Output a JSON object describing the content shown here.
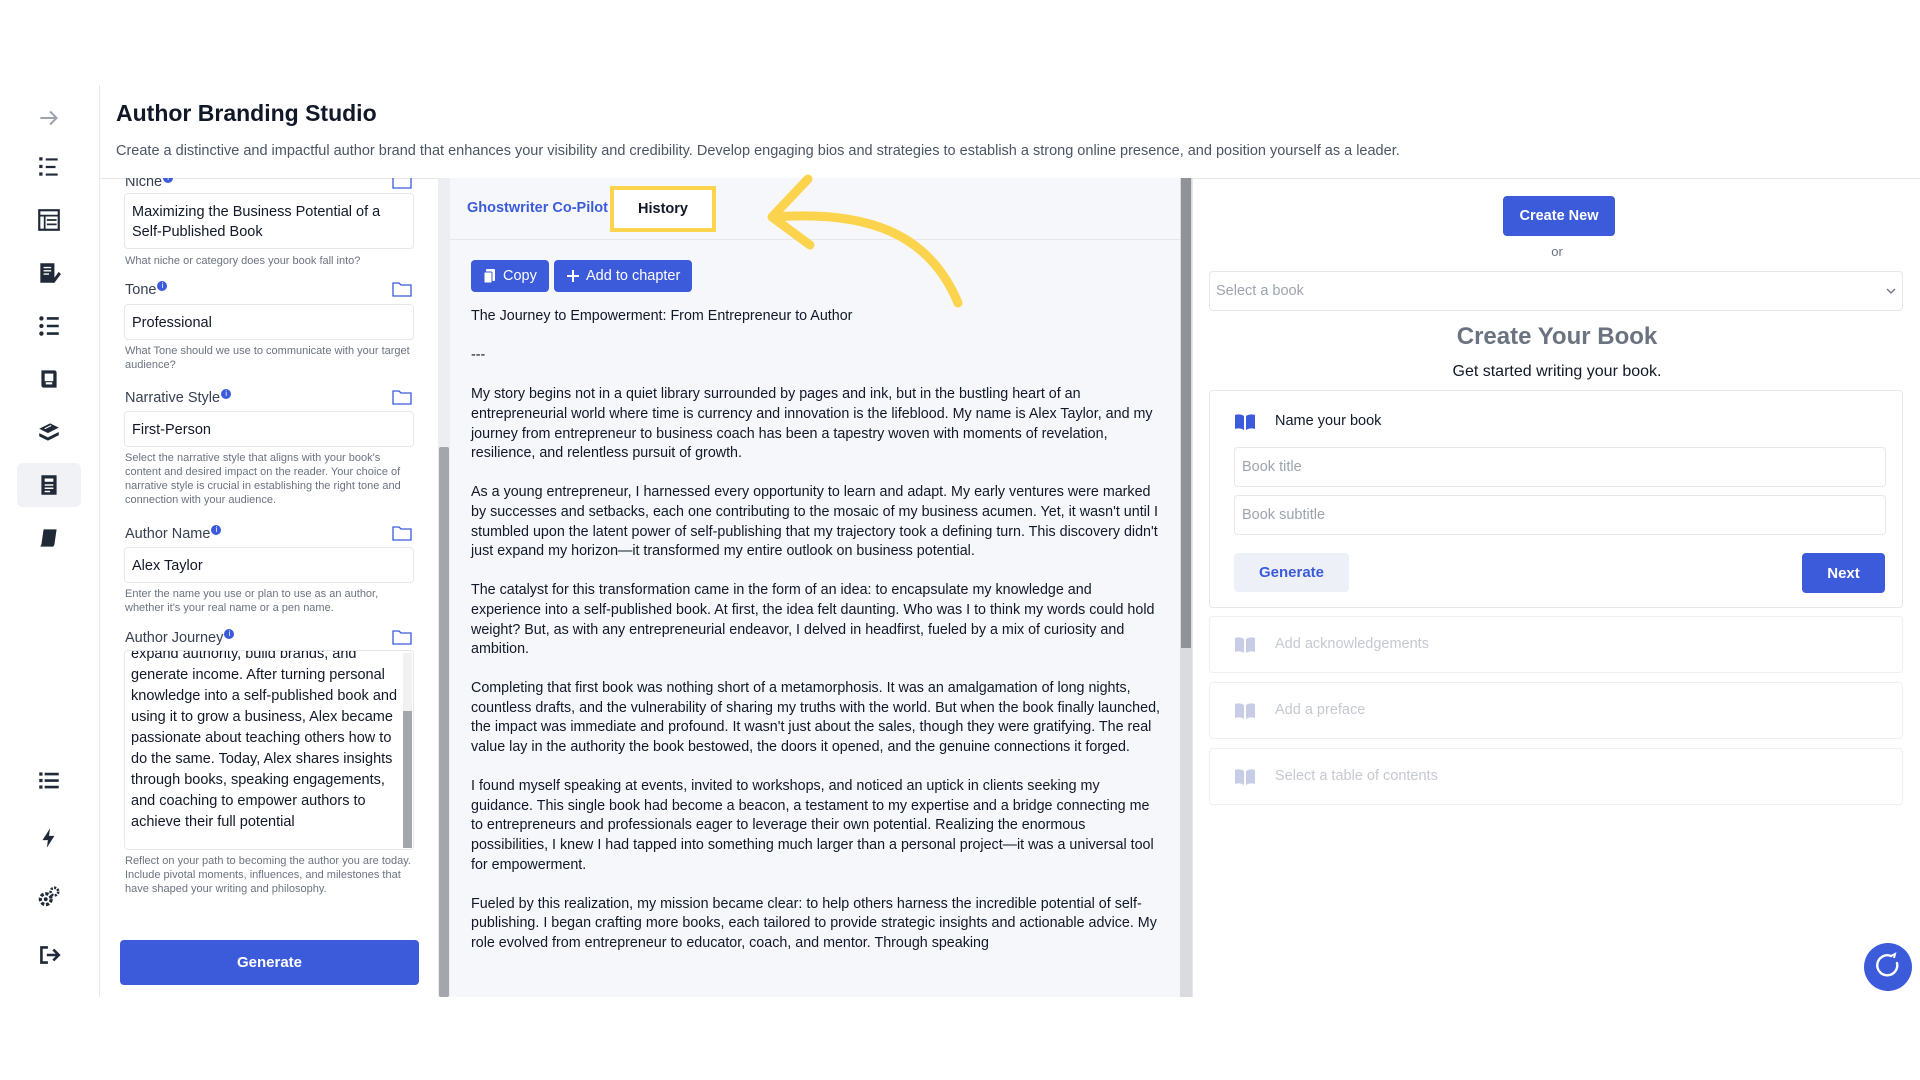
{
  "header": {
    "title": "Author Branding Studio",
    "description": "Create a distinctive and impactful author brand that enhances your visibility and credibility. Develop engaging bios and strategies to establish a strong online presence, and position yourself as a leader."
  },
  "sidebar": {
    "top_icons": [
      "arrow-right-icon",
      "numbered-list-icon",
      "table-layout-icon",
      "notebook-edit-icon",
      "checklist-icon",
      "book-reader-icon",
      "books-stack-icon",
      "author-branding-icon",
      "closed-book-icon"
    ],
    "bottom_icons": [
      "list-icon",
      "lightning-icon",
      "settings-gears-icon",
      "logout-icon"
    ]
  },
  "form": {
    "niche": {
      "label": "Niche",
      "value": "Maximizing the Business Potential of a Self-Published Book",
      "help": "What niche or category does your book fall into?"
    },
    "tone": {
      "label": "Tone",
      "value": "Professional",
      "help": "What Tone should we use to communicate with your target audience?"
    },
    "narrative_style": {
      "label": "Narrative Style",
      "value": "First-Person",
      "help": "Select the narrative style that aligns with your book's content and desired impact on the reader. Your choice of narrative style is crucial in establishing the right tone and connection with your audience."
    },
    "author_name": {
      "label": "Author Name",
      "value": "Alex Taylor",
      "help": "Enter the name you use or plan to use as an author, whether it's your real name or a pen name."
    },
    "author_journey": {
      "label": "Author Journey",
      "value": "expand authority, build brands, and generate income. After turning personal knowledge into a self-published book and using it to grow a business, Alex became passionate about teaching others how to do the same. Today, Alex shares insights through books, speaking engagements, and coaching to empower authors to achieve their full potential",
      "help": "Reflect on your path to becoming the author you are today. Include pivotal moments, influences, and milestones that have shaped your writing and philosophy."
    },
    "generate_label": "Generate"
  },
  "middle": {
    "tabs": [
      "Ghostwriter Co-Pilot",
      "History"
    ],
    "copy_label": "Copy",
    "add_chapter_label": "Add to chapter",
    "story": [
      "The Journey to Empowerment: From Entrepreneur to Author",
      "---",
      "My story begins not in a quiet library surrounded by pages and ink, but in the bustling heart of an entrepreneurial world where time is currency and innovation is the lifeblood. My name is Alex Taylor, and my journey from entrepreneur to business coach has been a tapestry woven with moments of revelation, resilience, and relentless pursuit of growth.",
      "As a young entrepreneur, I harnessed every opportunity to learn and adapt. My early ventures were marked by successes and setbacks, each one contributing to the mosaic of my business acumen. Yet, it wasn't until I stumbled upon the latent power of self-publishing that my trajectory took a defining turn. This discovery didn't just expand my horizon—it transformed my entire outlook on business potential.",
      "The catalyst for this transformation came in the form of an idea: to encapsulate my knowledge and experience into a self-published book. At first, the idea felt daunting. Who was I to think my words could hold weight? But, as with any entrepreneurial endeavor, I delved in headfirst, fueled by a mix of curiosity and ambition.",
      "Completing that first book was nothing short of a metamorphosis. It was an amalgamation of long nights, countless drafts, and the vulnerability of sharing my truths with the world. But when the book finally launched, the impact was immediate and profound. It wasn't just about the sales, though they were gratifying. The real value lay in the authority the book bestowed, the doors it opened, and the genuine connections it forged.",
      "I found myself speaking at events, invited to workshops, and noticed an uptick in clients seeking my guidance. This single book had become a beacon, a testament to my expertise and a bridge connecting me to entrepreneurs and professionals eager to leverage their own potential. Realizing the enormous possibilities, I knew I had tapped into something much larger than a personal project—it was a universal tool for empowerment.",
      "Fueled by this realization, my mission became clear: to help others harness the incredible potential of self-publishing. I began crafting more books, each tailored to provide strategic insights and actionable advice. My role evolved from entrepreneur to educator, coach, and mentor. Through speaking"
    ]
  },
  "right": {
    "create_new_label": "Create New",
    "or_label": "or",
    "select_placeholder": "Select a book",
    "create_title": "Create Your Book",
    "create_subtitle": "Get started writing your book.",
    "name_heading": "Name your book",
    "title_placeholder": "Book title",
    "subtitle_placeholder": "Book subtitle",
    "generate_label": "Generate",
    "next_label": "Next",
    "steps": [
      "Add acknowledgements",
      "Add a preface",
      "Select a table of contents"
    ]
  },
  "colors": {
    "accent": "#3b5bdb",
    "highlight": "#fcd34d"
  }
}
